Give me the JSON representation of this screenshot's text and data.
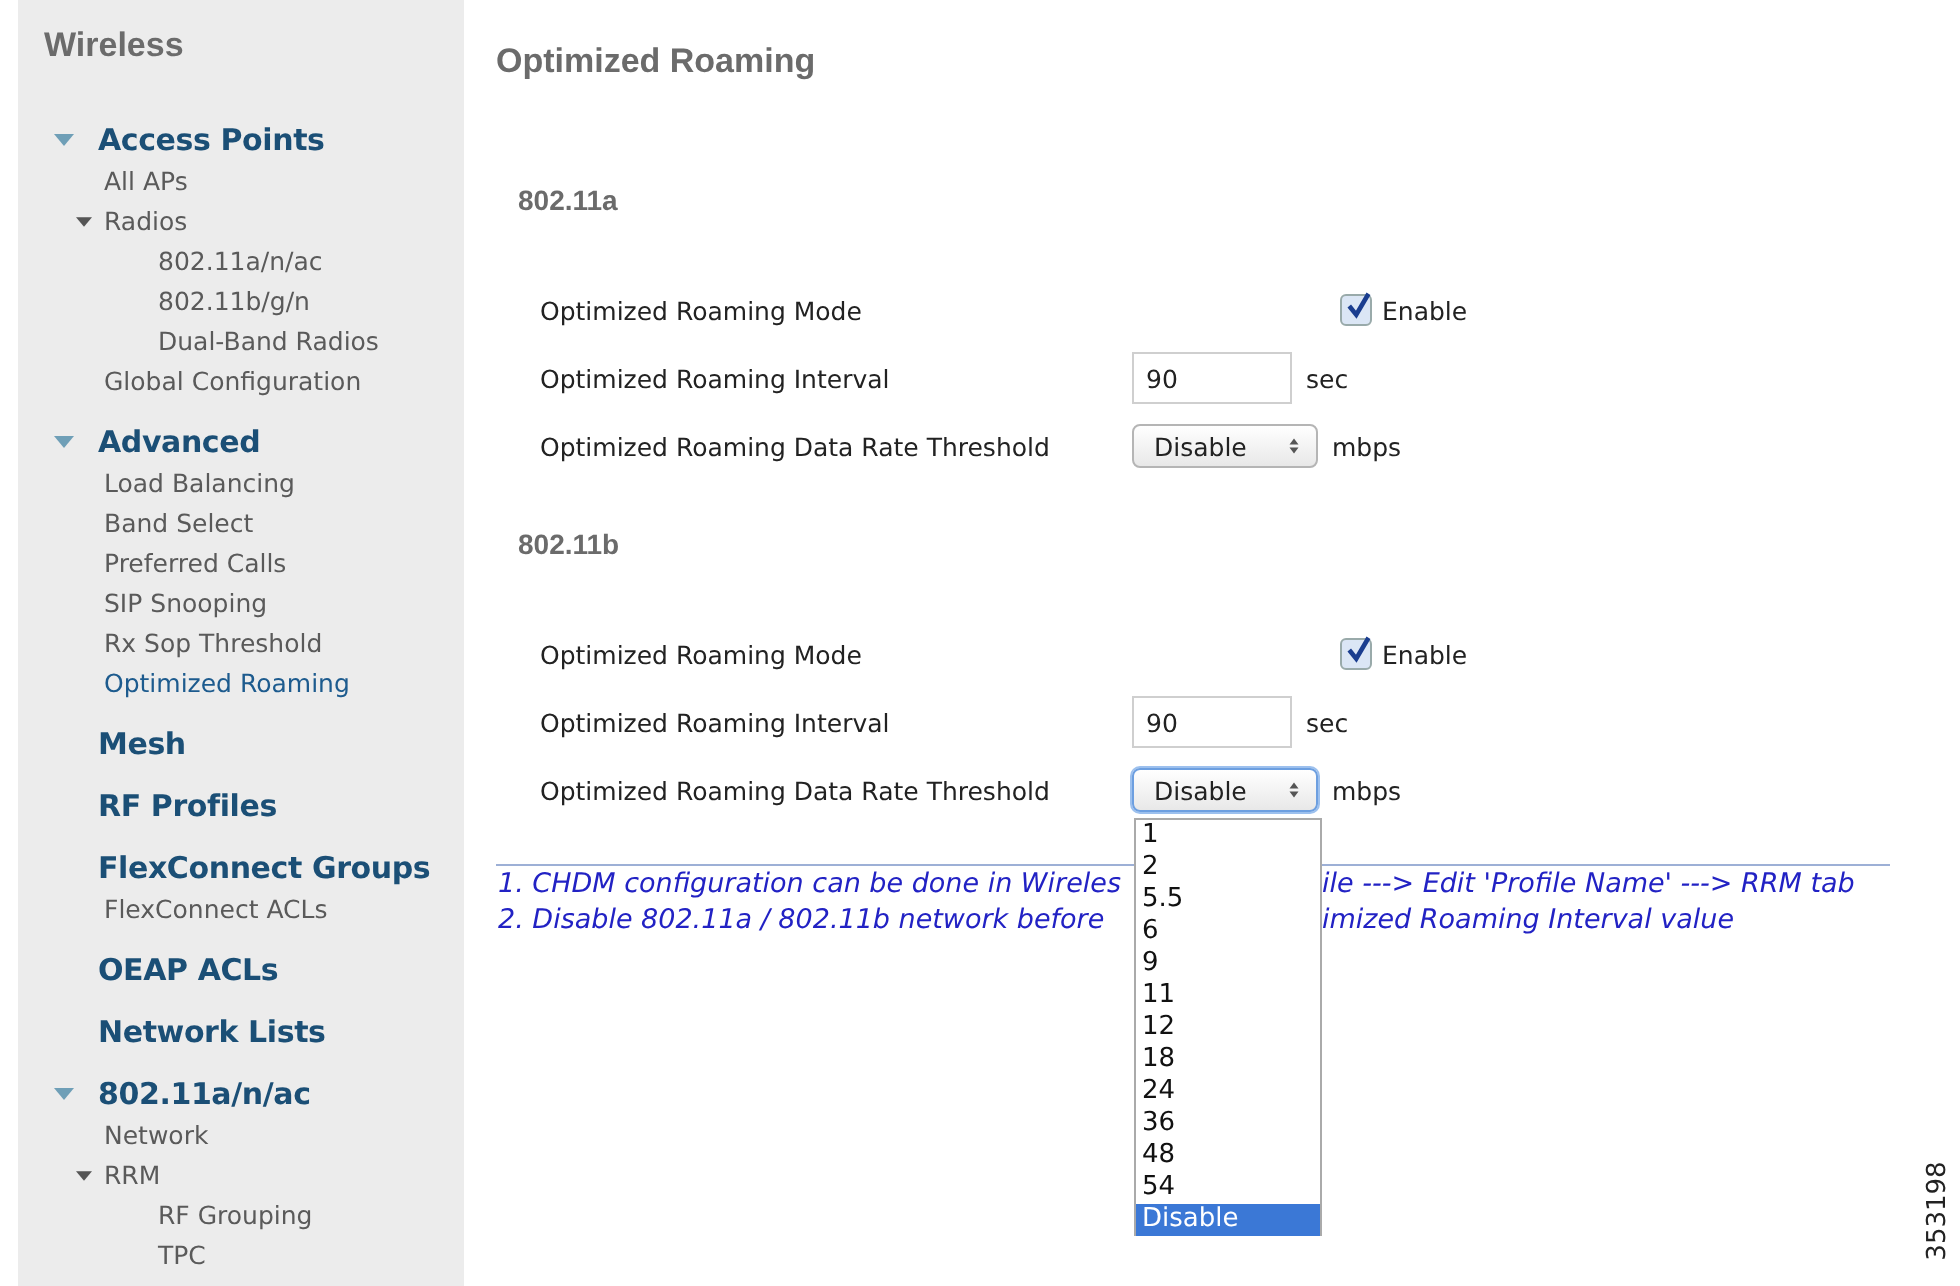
{
  "sidebar": {
    "title": "Wireless",
    "sections": [
      {
        "label": "Access Points",
        "expanded": true,
        "items": [
          {
            "label": "All APs",
            "selected": false
          },
          {
            "label": "Radios",
            "selected": false,
            "expanded": true,
            "children": [
              {
                "label": "802.11a/n/ac",
                "selected": false
              },
              {
                "label": "802.11b/g/n",
                "selected": false
              },
              {
                "label": "Dual-Band Radios",
                "selected": false
              }
            ]
          },
          {
            "label": "Global Configuration",
            "selected": false
          }
        ]
      },
      {
        "label": "Advanced",
        "expanded": true,
        "items": [
          {
            "label": "Load Balancing",
            "selected": false
          },
          {
            "label": "Band Select",
            "selected": false
          },
          {
            "label": "Preferred Calls",
            "selected": false
          },
          {
            "label": "SIP Snooping",
            "selected": false
          },
          {
            "label": "Rx Sop Threshold",
            "selected": false
          },
          {
            "label": "Optimized Roaming",
            "selected": true
          }
        ]
      },
      {
        "label": "Mesh"
      },
      {
        "label": "RF Profiles"
      },
      {
        "label": "FlexConnect Groups",
        "items": [
          {
            "label": "FlexConnect ACLs",
            "selected": false
          }
        ]
      },
      {
        "label": "OEAP ACLs"
      },
      {
        "label": "Network Lists"
      },
      {
        "label": "802.11a/n/ac",
        "expanded": true,
        "items": [
          {
            "label": "Network",
            "selected": false
          },
          {
            "label": "RRM",
            "selected": false,
            "expanded": true,
            "children": [
              {
                "label": "RF Grouping",
                "selected": false
              },
              {
                "label": "TPC",
                "selected": false
              }
            ]
          }
        ]
      }
    ]
  },
  "title": "Optimized Roaming",
  "bands": [
    {
      "name": "802.11a",
      "mode": {
        "label": "Optimized Roaming Mode",
        "checked": true,
        "option": "Enable"
      },
      "interval": {
        "label": "Optimized Roaming Interval",
        "value": "90",
        "unit": "sec"
      },
      "threshold": {
        "label": "Optimized Roaming Data Rate Threshold",
        "value": "Disable",
        "unit": "mbps",
        "open": false
      }
    },
    {
      "name": "802.11b",
      "mode": {
        "label": "Optimized Roaming Mode",
        "checked": true,
        "option": "Enable"
      },
      "interval": {
        "label": "Optimized Roaming Interval",
        "value": "90",
        "unit": "sec"
      },
      "threshold": {
        "label": "Optimized Roaming Data Rate Threshold",
        "value": "Disable",
        "unit": "mbps",
        "open": true,
        "options": [
          {
            "label": "1",
            "selected": false
          },
          {
            "label": "2",
            "selected": false
          },
          {
            "label": "5.5",
            "selected": false
          },
          {
            "label": "6",
            "selected": false
          },
          {
            "label": "9",
            "selected": false
          },
          {
            "label": "11",
            "selected": false
          },
          {
            "label": "12",
            "selected": false
          },
          {
            "label": "18",
            "selected": false
          },
          {
            "label": "24",
            "selected": false
          },
          {
            "label": "36",
            "selected": false
          },
          {
            "label": "48",
            "selected": false
          },
          {
            "label": "54",
            "selected": false
          },
          {
            "label": "Disable",
            "selected": true
          }
        ]
      }
    }
  ],
  "notes": [
    {
      "parts": [
        "1. CHDM configuration can be done in Wireles",
        "ile ---> Edit 'Profile Name' ---> RRM tab"
      ]
    },
    {
      "parts": [
        "2. Disable 802.11a / 802.11b network before",
        "imized Roaming Interval value"
      ]
    }
  ],
  "figure_id": "353198"
}
